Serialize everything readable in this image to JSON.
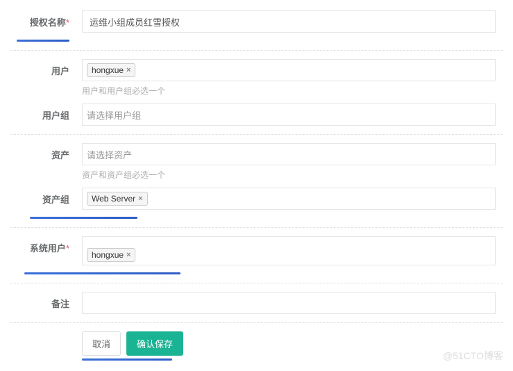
{
  "fields": {
    "authName": {
      "label": "授权名称",
      "value": "运维小组成员红雪授权",
      "required": true
    },
    "user": {
      "label": "用户",
      "tags": [
        "hongxue"
      ],
      "help": "用户和用户组必选一个"
    },
    "userGroup": {
      "label": "用户组",
      "placeholder": "请选择用户组"
    },
    "asset": {
      "label": "资产",
      "placeholder": "请选择资产",
      "help": "资产和资产组必选一个"
    },
    "assetGroup": {
      "label": "资产组",
      "tags": [
        "Web Server"
      ]
    },
    "systemUser": {
      "label": "系统用户",
      "tags": [
        "hongxue"
      ],
      "required": true
    },
    "remark": {
      "label": "备注",
      "value": ""
    }
  },
  "buttons": {
    "cancel": "取消",
    "save": "确认保存"
  },
  "watermark": "@51CTO博客",
  "icons": {
    "close": "×"
  }
}
